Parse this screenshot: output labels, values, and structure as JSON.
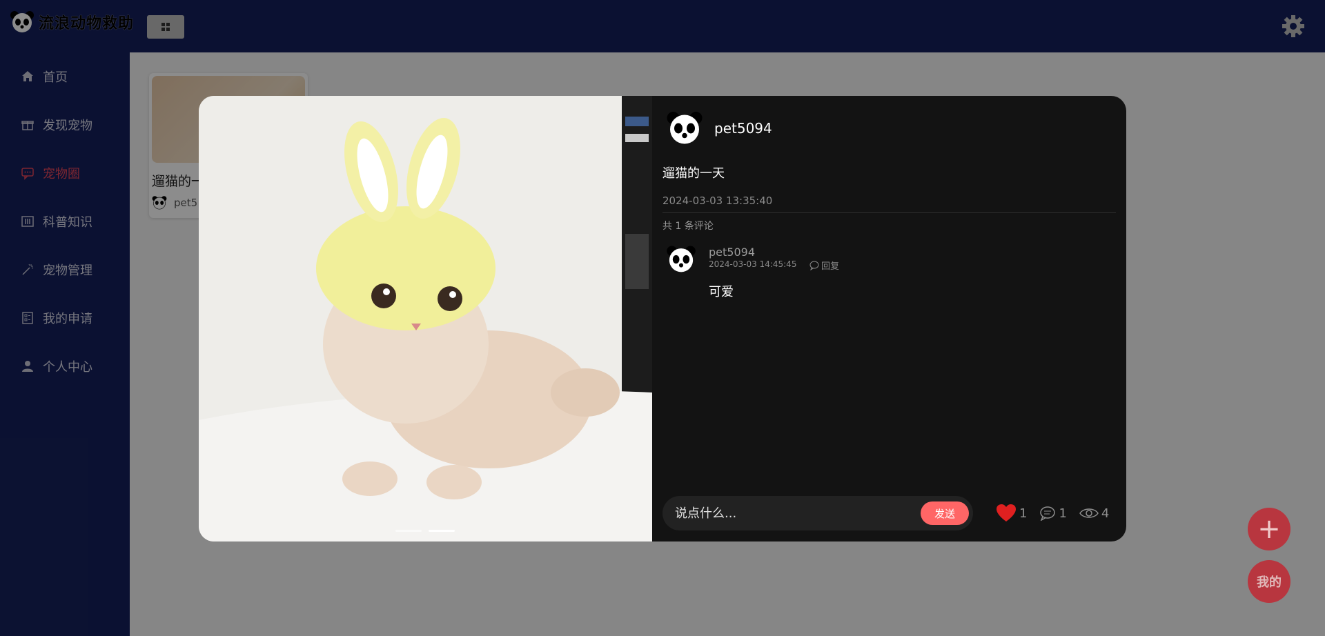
{
  "app": {
    "title": "流浪动物救助"
  },
  "sidebar": {
    "items": [
      {
        "label": "首页",
        "icon": "home-icon"
      },
      {
        "label": "发现宠物",
        "icon": "gift-icon"
      },
      {
        "label": "宠物圈",
        "icon": "chat-icon",
        "active": true
      },
      {
        "label": "科普知识",
        "icon": "book-icon"
      },
      {
        "label": "宠物管理",
        "icon": "magic-icon"
      },
      {
        "label": "我的申请",
        "icon": "form-icon"
      },
      {
        "label": "个人中心",
        "icon": "user-icon"
      }
    ]
  },
  "card": {
    "title": "遛猫的一",
    "user": "pet5"
  },
  "post": {
    "author": "pet5094",
    "title": "遛猫的一天",
    "time": "2024-03-03 13:35:40",
    "comment_count": "共 1 条评论",
    "comments": [
      {
        "user": "pet5094",
        "time": "2024-03-03 14:45:45",
        "reply_label": "回复",
        "text": "可爱"
      }
    ],
    "input_placeholder": "说点什么...",
    "send_label": "发送",
    "likes": "1",
    "comments_num": "1",
    "views": "4",
    "slides": 2,
    "active_slide": 2
  },
  "fab": {
    "plus": "+",
    "mine": "我的"
  },
  "colors": {
    "header": "#15205b",
    "active": "#e6455a",
    "send": "#ff6666",
    "fab": "#b8363f"
  }
}
